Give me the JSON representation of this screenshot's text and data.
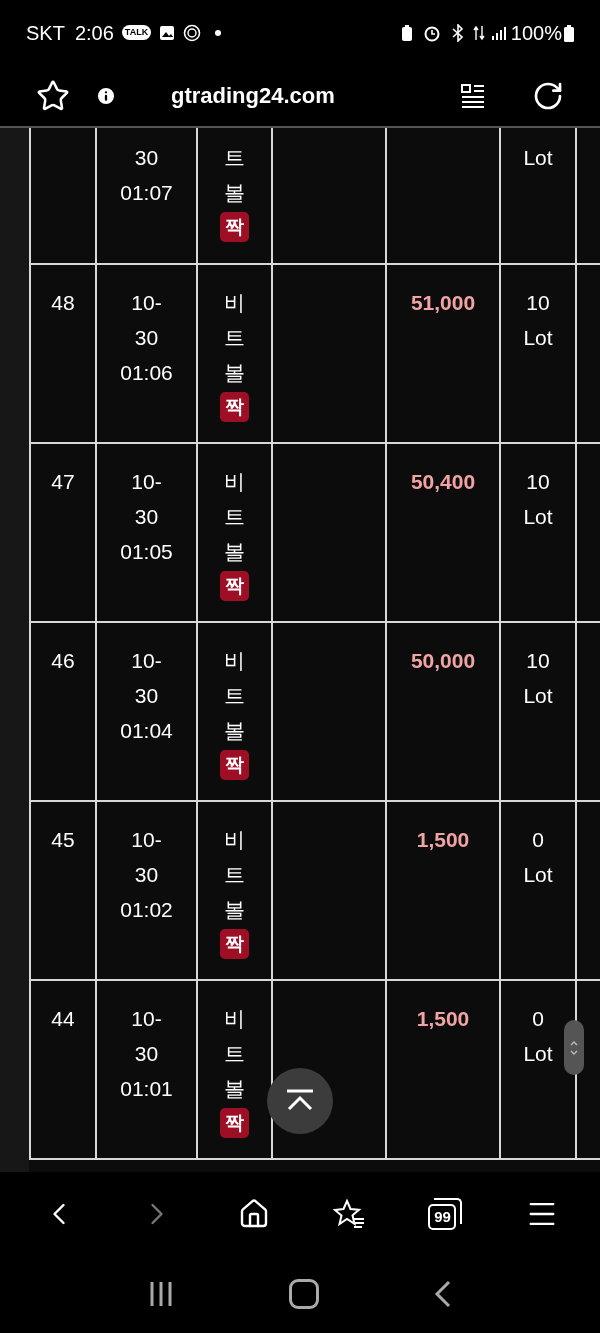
{
  "status_bar": {
    "carrier": "SKT",
    "time": "2:06",
    "talk_label": "TALK",
    "battery": "100%"
  },
  "address_bar": {
    "url": "gtrading24.com"
  },
  "rows": [
    {
      "date": [
        "30",
        "01:07"
      ],
      "game": [
        "트",
        "볼"
      ],
      "badge": "짝",
      "lot": [
        "Lot"
      ]
    },
    {
      "number": "48",
      "date": [
        "10-",
        "30",
        "01:06"
      ],
      "game": [
        "비",
        "트",
        "볼"
      ],
      "badge": "짝",
      "amount": "51,000",
      "lot": [
        "10",
        "Lot"
      ]
    },
    {
      "number": "47",
      "date": [
        "10-",
        "30",
        "01:05"
      ],
      "game": [
        "비",
        "트",
        "볼"
      ],
      "badge": "짝",
      "amount": "50,400",
      "lot": [
        "10",
        "Lot"
      ]
    },
    {
      "number": "46",
      "date": [
        "10-",
        "30",
        "01:04"
      ],
      "game": [
        "비",
        "트",
        "볼"
      ],
      "badge": "짝",
      "amount": "50,000",
      "lot": [
        "10",
        "Lot"
      ]
    },
    {
      "number": "45",
      "date": [
        "10-",
        "30",
        "01:02"
      ],
      "game": [
        "비",
        "트",
        "볼"
      ],
      "badge": "짝",
      "amount": "1,500",
      "lot": [
        "0",
        "Lot"
      ]
    },
    {
      "number": "44",
      "date": [
        "10-",
        "30",
        "01:01"
      ],
      "game": [
        "비",
        "트",
        "볼"
      ],
      "badge": "짝",
      "amount": "1,500",
      "lot": [
        "0",
        "Lot"
      ]
    }
  ],
  "toolbar": {
    "tabs_count": "99",
    "forward_disabled": true
  }
}
